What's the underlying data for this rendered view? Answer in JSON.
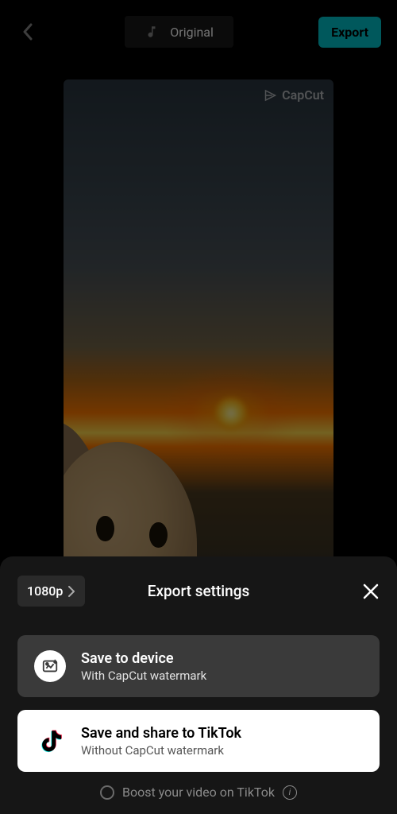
{
  "header": {
    "sound_label": "Original",
    "export_label": "Export"
  },
  "preview": {
    "watermark": "CapCut"
  },
  "panel": {
    "resolution": "1080p",
    "title": "Export settings",
    "options": [
      {
        "title": "Save to device",
        "subtitle": "With CapCut watermark"
      },
      {
        "title": "Save and share to TikTok",
        "subtitle": "Without CapCut watermark"
      }
    ],
    "boost_label": "Boost your video on TikTok"
  }
}
